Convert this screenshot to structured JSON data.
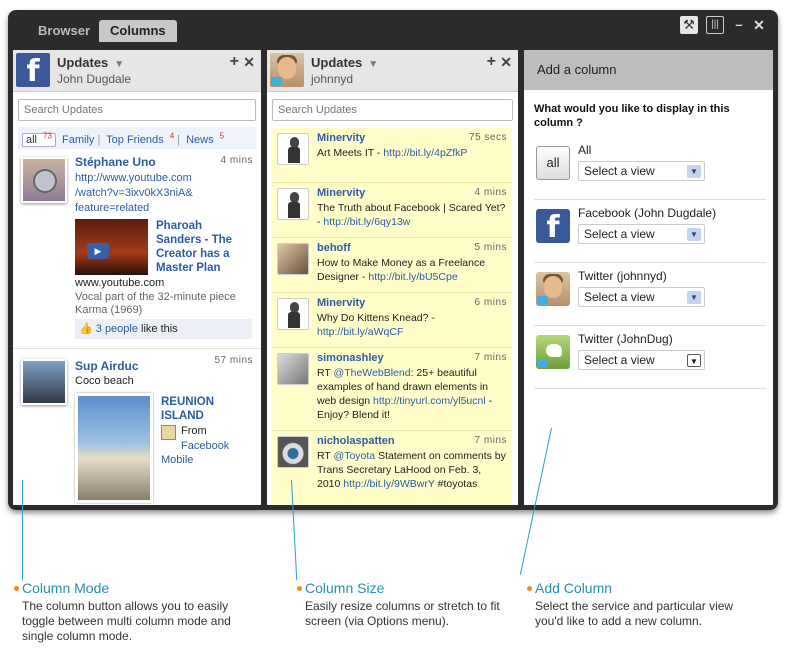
{
  "tabs": [
    {
      "label": "Browser"
    },
    {
      "label": "Columns"
    }
  ],
  "window_controls": [
    "wrench-icon",
    "panels-icon",
    "minimize-icon",
    "close-icon"
  ],
  "col1": {
    "title": "Updates",
    "subtitle": "John Dugdale",
    "search_placeholder": "Search Updates",
    "filters": [
      {
        "label": "all",
        "count": "73"
      },
      {
        "label": "Family",
        "count": ""
      },
      {
        "label": "Top Friends",
        "count": "4"
      },
      {
        "label": "News",
        "count": "5"
      }
    ],
    "posts": [
      {
        "name": "Stéphane Uno",
        "time": "4 mins",
        "link_lines": [
          "http://www.youtube.com",
          "/watch?v=3ixv0kX3niA&",
          "feature=related"
        ],
        "video_title_lines": [
          "Pharoah",
          "Sanders - The",
          "Creator has a",
          "Master Plan"
        ],
        "domain": "www.youtube.com",
        "caption_lines": [
          "Vocal part of the 32-minute piece",
          "Karma (1969)"
        ],
        "likes": "3 people",
        "likes_suffix": "like this"
      },
      {
        "name": "Sup Airduc",
        "time": "57 mins",
        "text": "Coco beach",
        "album_lines": [
          "REUNION",
          "ISLAND"
        ],
        "from_label": "From",
        "from_source_lines": [
          "Facebook",
          "Mobile"
        ]
      }
    ]
  },
  "col2": {
    "title": "Updates",
    "subtitle": "johnnyd",
    "search_placeholder": "Search Updates",
    "tweets": [
      {
        "name": "Minervity",
        "time": "75 secs",
        "text": "Art Meets IT - ",
        "link": "http://bit.ly/4pZfkP",
        "tail": ""
      },
      {
        "name": "Minervity",
        "time": "4 mins",
        "text": "The Truth about Facebook | Scared Yet? - ",
        "link": "http://bit.ly/6qy13w",
        "tail": ""
      },
      {
        "name": "behoff",
        "time": "5 mins",
        "text": "How to Make Money as a Freelance Designer - ",
        "link": "http://bit.ly/bU5Cpe",
        "tail": ""
      },
      {
        "name": "Minervity",
        "time": "6 mins",
        "text": "Why Do Kittens Knead? - ",
        "link": "http://bit.ly/aWqCF",
        "tail": ""
      },
      {
        "name": "simonashley",
        "time": "7 mins",
        "text": "RT ",
        "mention": "@TheWebBlend",
        "text2": ": 25+ beautiful examples of hand drawn elements in web design ",
        "link": "http://tinyurl.com/yl5ucnl",
        "tail": " - Enjoy? Blend it!"
      },
      {
        "name": "nicholaspatten",
        "time": "7 mins",
        "text": "RT ",
        "mention": "@Toyota",
        "text2": " Statement on comments by Trans Secretary LaHood on Feb. 3, 2010 ",
        "link": "http://bit.ly/9WBwrY",
        "tail": " #toyotas"
      }
    ]
  },
  "col3": {
    "header": "Add a column",
    "question": "What would you like to display in this column ?",
    "options": [
      {
        "label": "All",
        "select": "Select a view",
        "icon": "all-button",
        "icon_text": "all"
      },
      {
        "label": "Facebook (John Dugdale)",
        "select": "Select a view",
        "icon": "facebook-icon"
      },
      {
        "label": "Twitter (johnnyd)",
        "select": "Select a view",
        "icon": "twitter-user-icon"
      },
      {
        "label": "Twitter (JohnDug)",
        "select": "Select a view",
        "icon": "twitter-bird-icon"
      }
    ]
  },
  "callouts": [
    {
      "title": "Column Mode",
      "desc": "The column button allows you to easily toggle between multi column mode and single column mode."
    },
    {
      "title": "Column Size",
      "desc": "Easily resize columns or stretch to fit screen (via Options menu)."
    },
    {
      "title": "Add Column",
      "desc": "Select the service and particular view you'd like to add a new column."
    }
  ],
  "colors": {
    "accent": "#2a8fb0",
    "bullet": "#f08a24",
    "link": "#2d5ca6",
    "twitter_bg": "#fffdc8",
    "facebook": "#3b5998"
  }
}
